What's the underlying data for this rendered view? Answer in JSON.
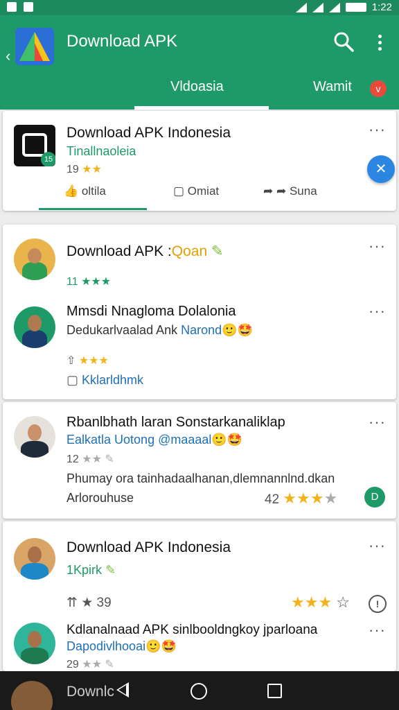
{
  "status_bar": {
    "time": "1:22"
  },
  "app_bar": {
    "title": "Download APK",
    "tabs": [
      {
        "label": "Vldoasia"
      },
      {
        "label": "Wamit",
        "badge": "v"
      }
    ]
  },
  "cards": {
    "app": {
      "title": "Download APK Indonesia",
      "subtitle": "Tinallnaoleia",
      "rating_count": "19",
      "icon_badge": "15",
      "actions": [
        {
          "label": "oltila"
        },
        {
          "label": "Omiat"
        },
        {
          "label": "Suna"
        }
      ]
    },
    "post1": {
      "title": "Download APK :",
      "title_tag": "Qoan",
      "rating_count": "11",
      "comment": {
        "name": "Mmsdi Nnagloma Dolalonia",
        "text": "Dedukarlvaalad Ank",
        "link": "Narond",
        "like_label": "",
        "reply_label": "Kklarldhmk"
      }
    },
    "post2": {
      "title": "Rbanlbhath laran Sonstarkanaliklap",
      "subtitle": "Ealkatla Uotong @maaaal",
      "rating_count": "12",
      "body": "Phumay ora tainhadaalhanan,dlemnannlnd.dkan",
      "footer": "Arlorouhuse",
      "score": "42"
    },
    "post3": {
      "title": "Download APK Indonesia",
      "subtitle": "1Kpirk",
      "stat": "39",
      "comment": {
        "name": "Kdlanalnaad APK sinlbooldngkoy jparloana",
        "text": "Dapodivlhooai",
        "rating_count": "29"
      },
      "peek_title": "Downlc"
    }
  },
  "colors": {
    "primary": "#1e9a68",
    "status_bar": "#1c8a5c",
    "fab": "#2a86e0",
    "star": "#f2b21b",
    "badge": "#e84b3c"
  },
  "icons": [
    "back-arrow-icon",
    "search-icon",
    "more-vert-icon",
    "like-icon",
    "comment-icon",
    "share-icon",
    "close-icon",
    "star-icon",
    "alert-icon",
    "nav-back-icon",
    "nav-home-icon",
    "nav-recent-icon"
  ]
}
